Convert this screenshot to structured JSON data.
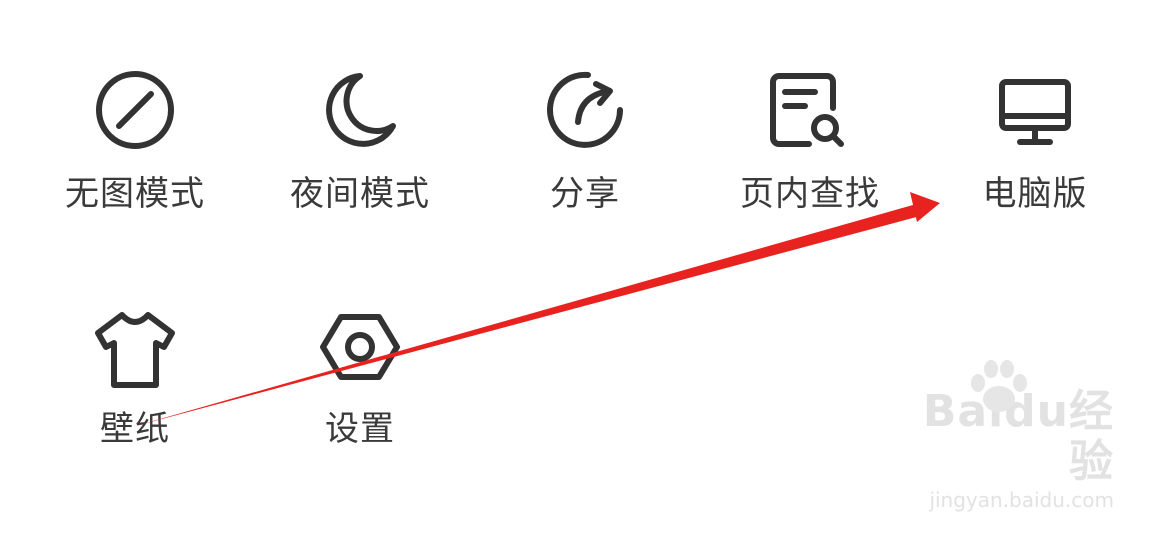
{
  "menu": {
    "items": [
      {
        "label": "无图模式",
        "icon": "no-image-icon"
      },
      {
        "label": "夜间模式",
        "icon": "moon-icon"
      },
      {
        "label": "分享",
        "icon": "share-icon"
      },
      {
        "label": "页内查找",
        "icon": "find-in-page-icon"
      },
      {
        "label": "电脑版",
        "icon": "monitor-icon"
      },
      {
        "label": "壁纸",
        "icon": "tshirt-icon"
      },
      {
        "label": "设置",
        "icon": "settings-hex-icon"
      }
    ]
  },
  "annotation": {
    "arrow_color": "#e8231f",
    "description_icon": "red-arrow-icon"
  },
  "watermark": {
    "brand": "Baidu经验",
    "domain": "jingyan.baidu.com"
  },
  "colors": {
    "icon_stroke": "#333333",
    "label_text": "#3a3a3a",
    "background": "#ffffff"
  }
}
